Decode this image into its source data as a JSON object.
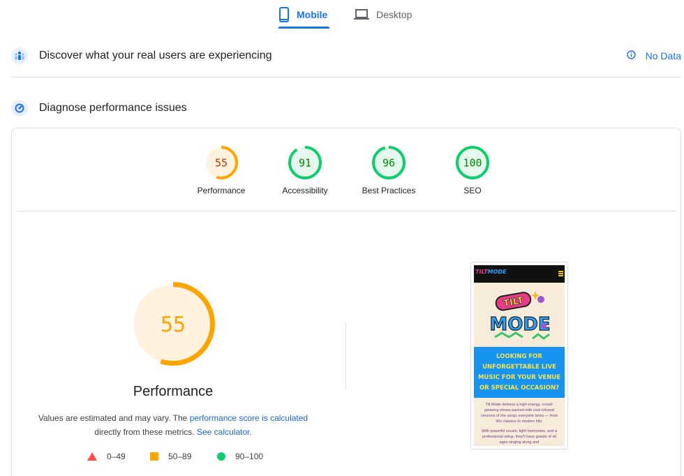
{
  "tabs": [
    {
      "label": "Mobile",
      "icon": "phone-icon",
      "active": true
    },
    {
      "label": "Desktop",
      "icon": "laptop-icon",
      "active": false
    }
  ],
  "field_section": {
    "title": "Discover what your real users are experiencing",
    "icon": "users-icon",
    "status": "No Data",
    "status_icon": "info-icon"
  },
  "lab_section": {
    "title": "Diagnose performance issues",
    "icon": "diagnose-icon"
  },
  "scores": [
    {
      "value": "55",
      "label": "Performance",
      "color": "#ffa400",
      "fraction": 0.55
    },
    {
      "value": "91",
      "label": "Accessibility",
      "color": "#0cce6b",
      "fraction": 0.91
    },
    {
      "value": "96",
      "label": "Best Practices",
      "color": "#0cce6b",
      "fraction": 0.96
    },
    {
      "value": "100",
      "label": "SEO",
      "color": "#0cce6b",
      "fraction": 1.0
    }
  ],
  "main_score": {
    "value": "55",
    "label": "Performance",
    "fraction": 0.55
  },
  "note": {
    "prefix": "Values are estimated and may vary. The",
    "link1": "performance score is calculated",
    "middle": "directly from these metrics.",
    "link2": "See calculator",
    "suffix": "."
  },
  "legend": [
    {
      "range": "0–49",
      "shape": "triangle",
      "color": "#ff4e42"
    },
    {
      "range": "50–89",
      "shape": "square",
      "color": "#ffa400"
    },
    {
      "range": "90–100",
      "shape": "circle",
      "color": "#0cce6b"
    }
  ],
  "preview": {
    "logo_a": "TILT",
    "logo_b": "MODE",
    "headline": "LOOKING FOR UNFORGETTABLE LIVE MUSIC FOR YOUR VENUE OR SPECIAL OCCASION?",
    "body1": "Tilt Mode delivers a high-energy, crowd-pleasing shows packed with rock-infused versions of the songs everyone loves — from 90s classics to modern hits.",
    "body2": "With powerful vocals, tight harmonies, and a professional setup, they'll have guests of all ages singing along and"
  },
  "colors": {
    "accent": "#1a73e8",
    "average": "#ffa400",
    "pass": "#0cce6b",
    "fail": "#ff4e42"
  }
}
